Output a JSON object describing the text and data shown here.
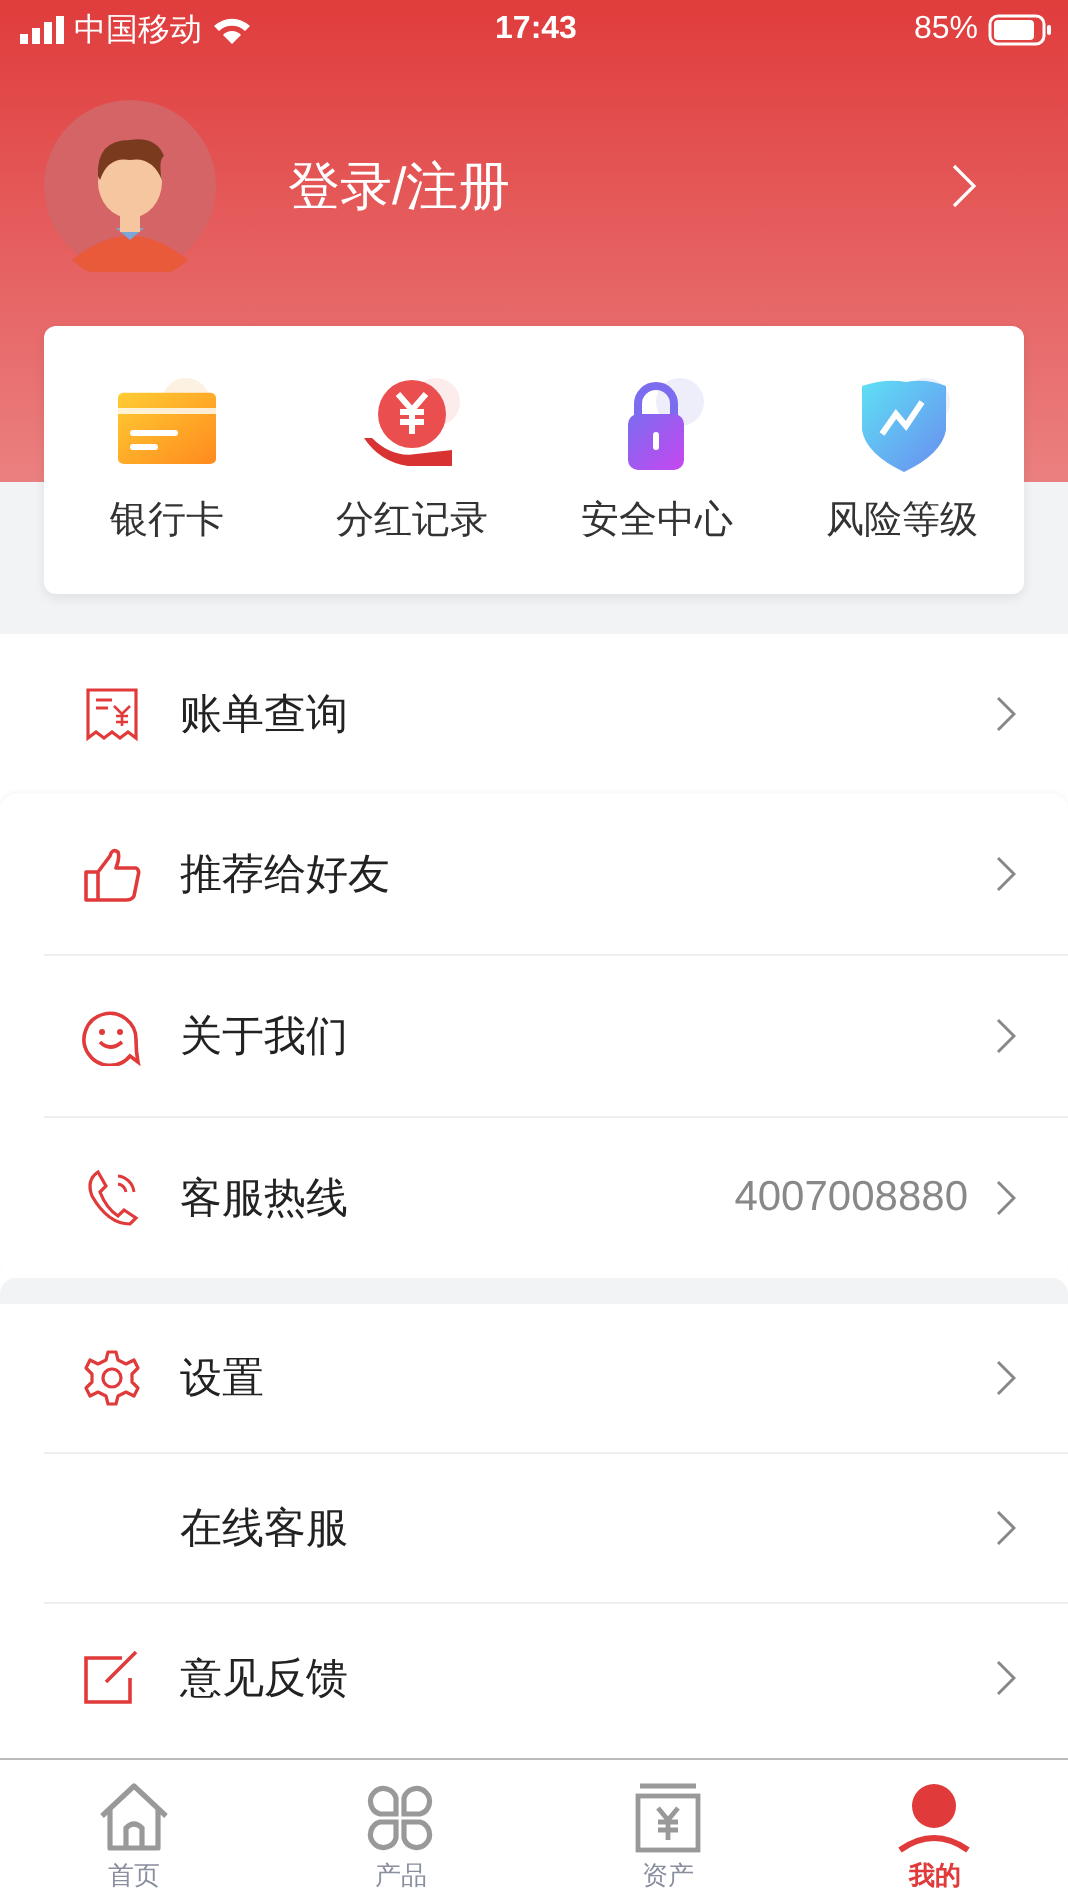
{
  "status_bar": {
    "carrier": "中国移动",
    "time": "17:43",
    "battery": "85%"
  },
  "profile": {
    "login_label": "登录/注册"
  },
  "shortcuts": [
    {
      "label": "银行卡"
    },
    {
      "label": "分红记录"
    },
    {
      "label": "安全中心"
    },
    {
      "label": "风险等级"
    }
  ],
  "sections": [
    {
      "items": [
        {
          "label": "账单查询"
        }
      ]
    },
    {
      "items": [
        {
          "label": "推荐给好友"
        },
        {
          "label": "关于我们"
        },
        {
          "label": "客服热线",
          "value": "4007008880"
        }
      ]
    },
    {
      "items": [
        {
          "label": "设置"
        },
        {
          "label": "在线客服"
        },
        {
          "label": "意见反馈"
        }
      ]
    }
  ],
  "tab_bar": [
    {
      "label": "首页",
      "selected": false
    },
    {
      "label": "产品",
      "selected": false
    },
    {
      "label": "资产",
      "selected": false
    },
    {
      "label": "我的",
      "selected": true
    }
  ]
}
